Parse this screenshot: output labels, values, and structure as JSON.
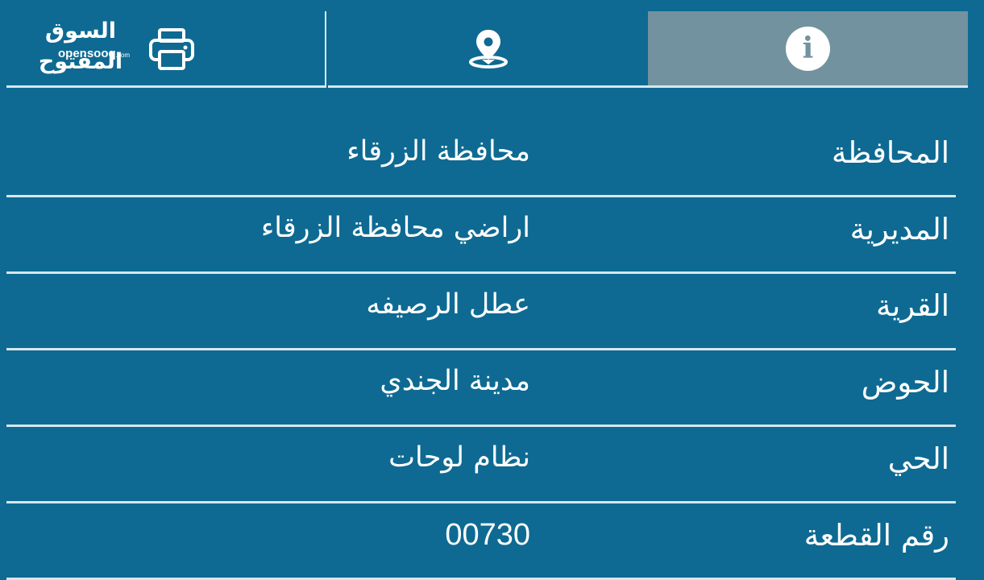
{
  "header": {
    "logo_arabic": "السوق المفتوح",
    "logo_english": "opensooq",
    "logo_domain": ".com",
    "tabs": [
      {
        "name": "print",
        "icon": "printer-icon"
      },
      {
        "name": "location",
        "icon": "location-pin-icon"
      },
      {
        "name": "info",
        "icon": "info-icon",
        "active": true
      }
    ]
  },
  "colors": {
    "background": "#0e6a92",
    "active_tab": "#72929f",
    "divider": "#d7e7ef",
    "text": "#ffffff"
  },
  "details": [
    {
      "label": "المحافظة",
      "value": "محافظة الزرقاء"
    },
    {
      "label": "المديرية",
      "value": "اراضي محافظة الزرقاء"
    },
    {
      "label": "القرية",
      "value": "عطل الرصيفه"
    },
    {
      "label": "الحوض",
      "value": "مدينة الجندي"
    },
    {
      "label": "الحي",
      "value": "نظام لوحات"
    },
    {
      "label": "رقم القطعة",
      "value": "00730"
    }
  ]
}
